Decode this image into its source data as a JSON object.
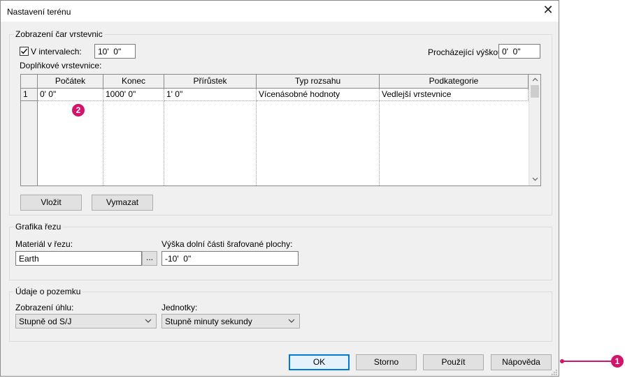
{
  "window": {
    "title": "Nastavení terénu",
    "close_glyph": "✕"
  },
  "contours": {
    "group_label": "Zobrazení čar vrstevnic",
    "interval_checkbox_label": "V intervalech:",
    "interval_checked": true,
    "interval_value": "10'  0\"",
    "passing_height_label": "Procházející výškou:",
    "passing_height_value": "0'  0\"",
    "additional_label": "Doplňkové vrstevnice:",
    "table": {
      "columns": [
        "Počátek",
        "Konec",
        "Přírůstek",
        "Typ rozsahu",
        "Podkategorie"
      ],
      "rows": [
        {
          "index": "1",
          "start": "0'  0\"",
          "end": "1000'  0\"",
          "increment": "1'  0\"",
          "range_type": "Vícenásobné hodnoty",
          "subcategory": "Vedlejší vrstevnice"
        }
      ]
    },
    "insert_button": "Vložit",
    "delete_button": "Vymazat"
  },
  "section_graphics": {
    "group_label": "Grafika řezu",
    "material_label": "Materiál v řezu:",
    "material_value": "Earth",
    "browse_button": "...",
    "height_label": "Výška dolní části šrafované plochy:",
    "height_value": "-10'  0\""
  },
  "property_data": {
    "group_label": "Údaje o pozemku",
    "angle_label": "Zobrazení úhlu:",
    "angle_value": "Stupně od S/J",
    "units_label": "Jednotky:",
    "units_value": "Stupně minuty sekundy"
  },
  "footer": {
    "ok": "OK",
    "cancel": "Storno",
    "apply": "Použít",
    "help": "Nápověda"
  },
  "callouts": {
    "one": "1",
    "two": "2",
    "color": "#d4146c"
  }
}
